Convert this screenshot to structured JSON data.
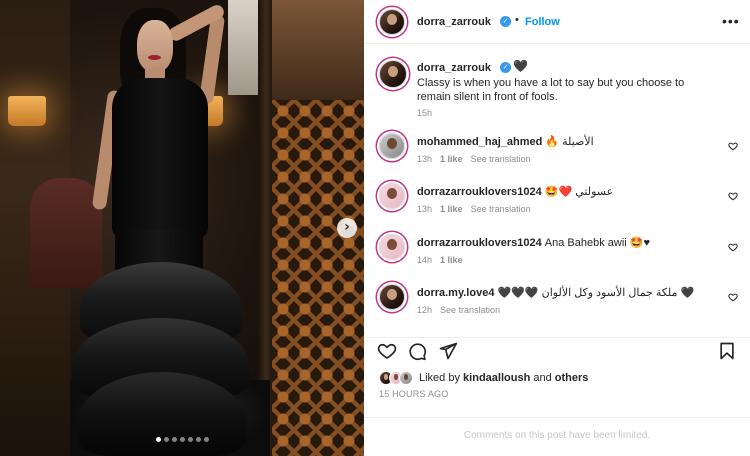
{
  "post": {
    "author": "dorra_zarrouk",
    "verified_badge": "✓",
    "follow_label": "Follow",
    "more_label": "•••",
    "header_separator": "•"
  },
  "caption": {
    "user": "dorra_zarrouk",
    "emoji": "🖤",
    "text": "Classy is when you have a lot to say but you choose to remain silent in front of fools.",
    "time": "15h"
  },
  "comments": [
    {
      "user": "mohammed_haj_ahmed",
      "text": "🔥 الأصيلة",
      "time": "13h",
      "likes": "1 like",
      "translate": "See translation",
      "avatar": "man"
    },
    {
      "user": "dorrazarrouklovers1024",
      "text": "🤩❤️ عسولتي",
      "time": "13h",
      "likes": "1 like",
      "translate": "See translation",
      "avatar": "pink"
    },
    {
      "user": "dorrazarrouklovers1024",
      "text": "Ana Bahebk awii 🤩♥",
      "time": "14h",
      "likes": "1 like",
      "translate": "",
      "avatar": "pink"
    },
    {
      "user": "dorra.my.love4",
      "text": "🖤🖤🖤 ملكة جمال الأسود وكل الألوان 🖤",
      "time": "12h",
      "likes": "",
      "translate": "See translation",
      "avatar": "dark"
    }
  ],
  "likes": {
    "prefix": "Liked by",
    "user": "kindaalloush",
    "and": "and",
    "others": "others"
  },
  "post_time": "15 HOURS AGO",
  "comments_limited": "Comments on this post have been limited.",
  "carousel": {
    "count": 7,
    "active_index": 0,
    "next_label": "›"
  },
  "icons": [
    "heart-icon",
    "comment-icon",
    "share-icon",
    "bookmark-icon"
  ],
  "colors": {
    "accent": "#0095f6",
    "verified": "#3897f0",
    "muted": "#8e8e8e"
  }
}
